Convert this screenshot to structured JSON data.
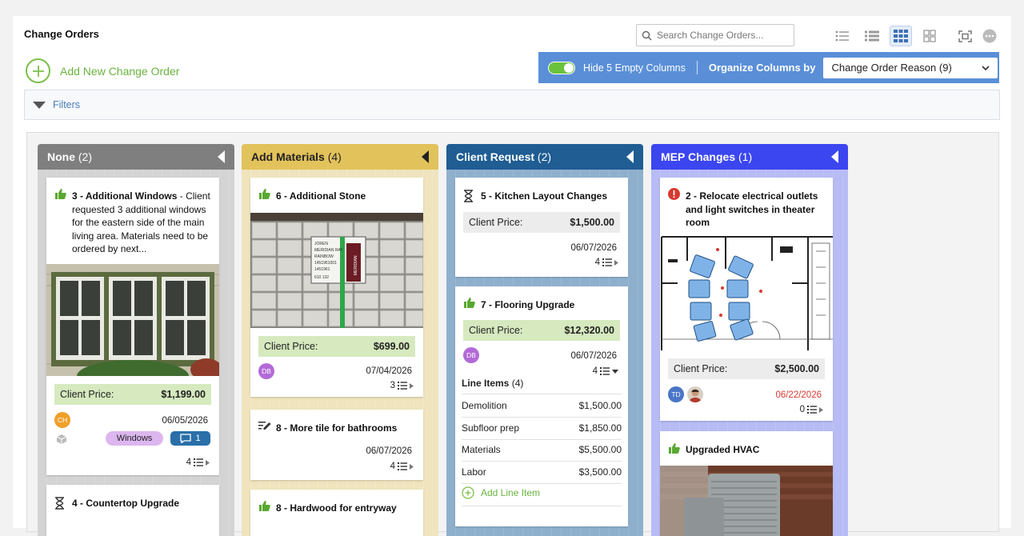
{
  "page": {
    "title": "Change Orders"
  },
  "search": {
    "placeholder": "Search Change Orders..."
  },
  "toolbar": {
    "view_icons": [
      "list-view-icon",
      "compact-list-view-icon",
      "board-view-icon",
      "grid-view-icon",
      "fullscreen-icon",
      "more-options-icon"
    ],
    "active_view": "board-view-icon"
  },
  "add": {
    "label": "Add New Change Order"
  },
  "org": {
    "hide_label": "Hide 5 Empty Columns",
    "hide_on": true,
    "organize_label": "Organize Columns by",
    "selected": "Change Order Reason (9)"
  },
  "filters": {
    "label": "Filters"
  },
  "columns": [
    {
      "name": "None",
      "count": "(2)",
      "color": "#7f7f7f",
      "body": "#d4d4d4"
    },
    {
      "name": "Add Materials",
      "count": "(4)",
      "color": "#e2c25b",
      "body": "#efe4bd"
    },
    {
      "name": "Client Request",
      "count": "(2)",
      "color": "#1f5d93",
      "body": "#8fb0cd"
    },
    {
      "name": "MEP Changes",
      "count": "(1)",
      "color": "#3b46f0",
      "body": "#b7bcf5"
    }
  ],
  "cards": {
    "c3": {
      "title": "3 - Additional Windows",
      "desc": " - Client requested 3 additional windows for the eastern side of the main living area. Materials need to be ordered by next...",
      "price_label": "Client Price:",
      "price": "$1,199.00",
      "avatar": "CH",
      "date": "06/05/2026",
      "tag": "Windows",
      "comments": "1",
      "items": "4"
    },
    "c4": {
      "title": "4 - Countertop Upgrade"
    },
    "c6": {
      "title": "6 - Additional Stone",
      "price_label": "Client Price:",
      "price": "$699.00",
      "avatar": "DB",
      "date": "07/04/2026",
      "items": "3",
      "photo_sign": [
        "JOREN",
        "MERIDIAN RAY",
        "RAINBOW",
        "1451961001",
        "1451961",
        "610 132"
      ],
      "photo_logo": "MERIDIAN"
    },
    "c8a": {
      "title": "8 - More tile for bathrooms",
      "date": "06/07/2026",
      "items": "4"
    },
    "c8b": {
      "title": "8 - Hardwood for entryway"
    },
    "c5": {
      "title": "5 - Kitchen Layout Changes",
      "price_label": "Client Price:",
      "price": "$1,500.00",
      "date": "06/07/2026",
      "items": "4"
    },
    "c7": {
      "title": "7 - Flooring Upgrade",
      "price_label": "Client Price:",
      "price": "$12,320.00",
      "avatar": "DB",
      "date": "06/07/2026",
      "items": "4",
      "line_items_label": "Line Items",
      "line_items_count": "(4)",
      "lines": [
        {
          "name": "Demolition",
          "amount": "$1,500.00"
        },
        {
          "name": "Subfloor prep",
          "amount": "$1,850.00"
        },
        {
          "name": "Materials",
          "amount": "$5,500.00"
        },
        {
          "name": "Labor",
          "amount": "$3,500.00"
        }
      ],
      "add_line": "Add Line Item"
    },
    "c2": {
      "title": "2 - Relocate electrical outlets and light switches in theater room",
      "price_label": "Client Price:",
      "price": "$2,500.00",
      "avatar": "TD",
      "date": "06/22/2026",
      "items": "0"
    },
    "cH": {
      "title": "Upgraded HVAC"
    }
  },
  "colors": {
    "green": "#6ab43e",
    "blue": "#5a8fd8",
    "overdue": "#d63a2f",
    "tag_purple": "#dcb6ee",
    "comment_blue": "#2a6fa9"
  }
}
